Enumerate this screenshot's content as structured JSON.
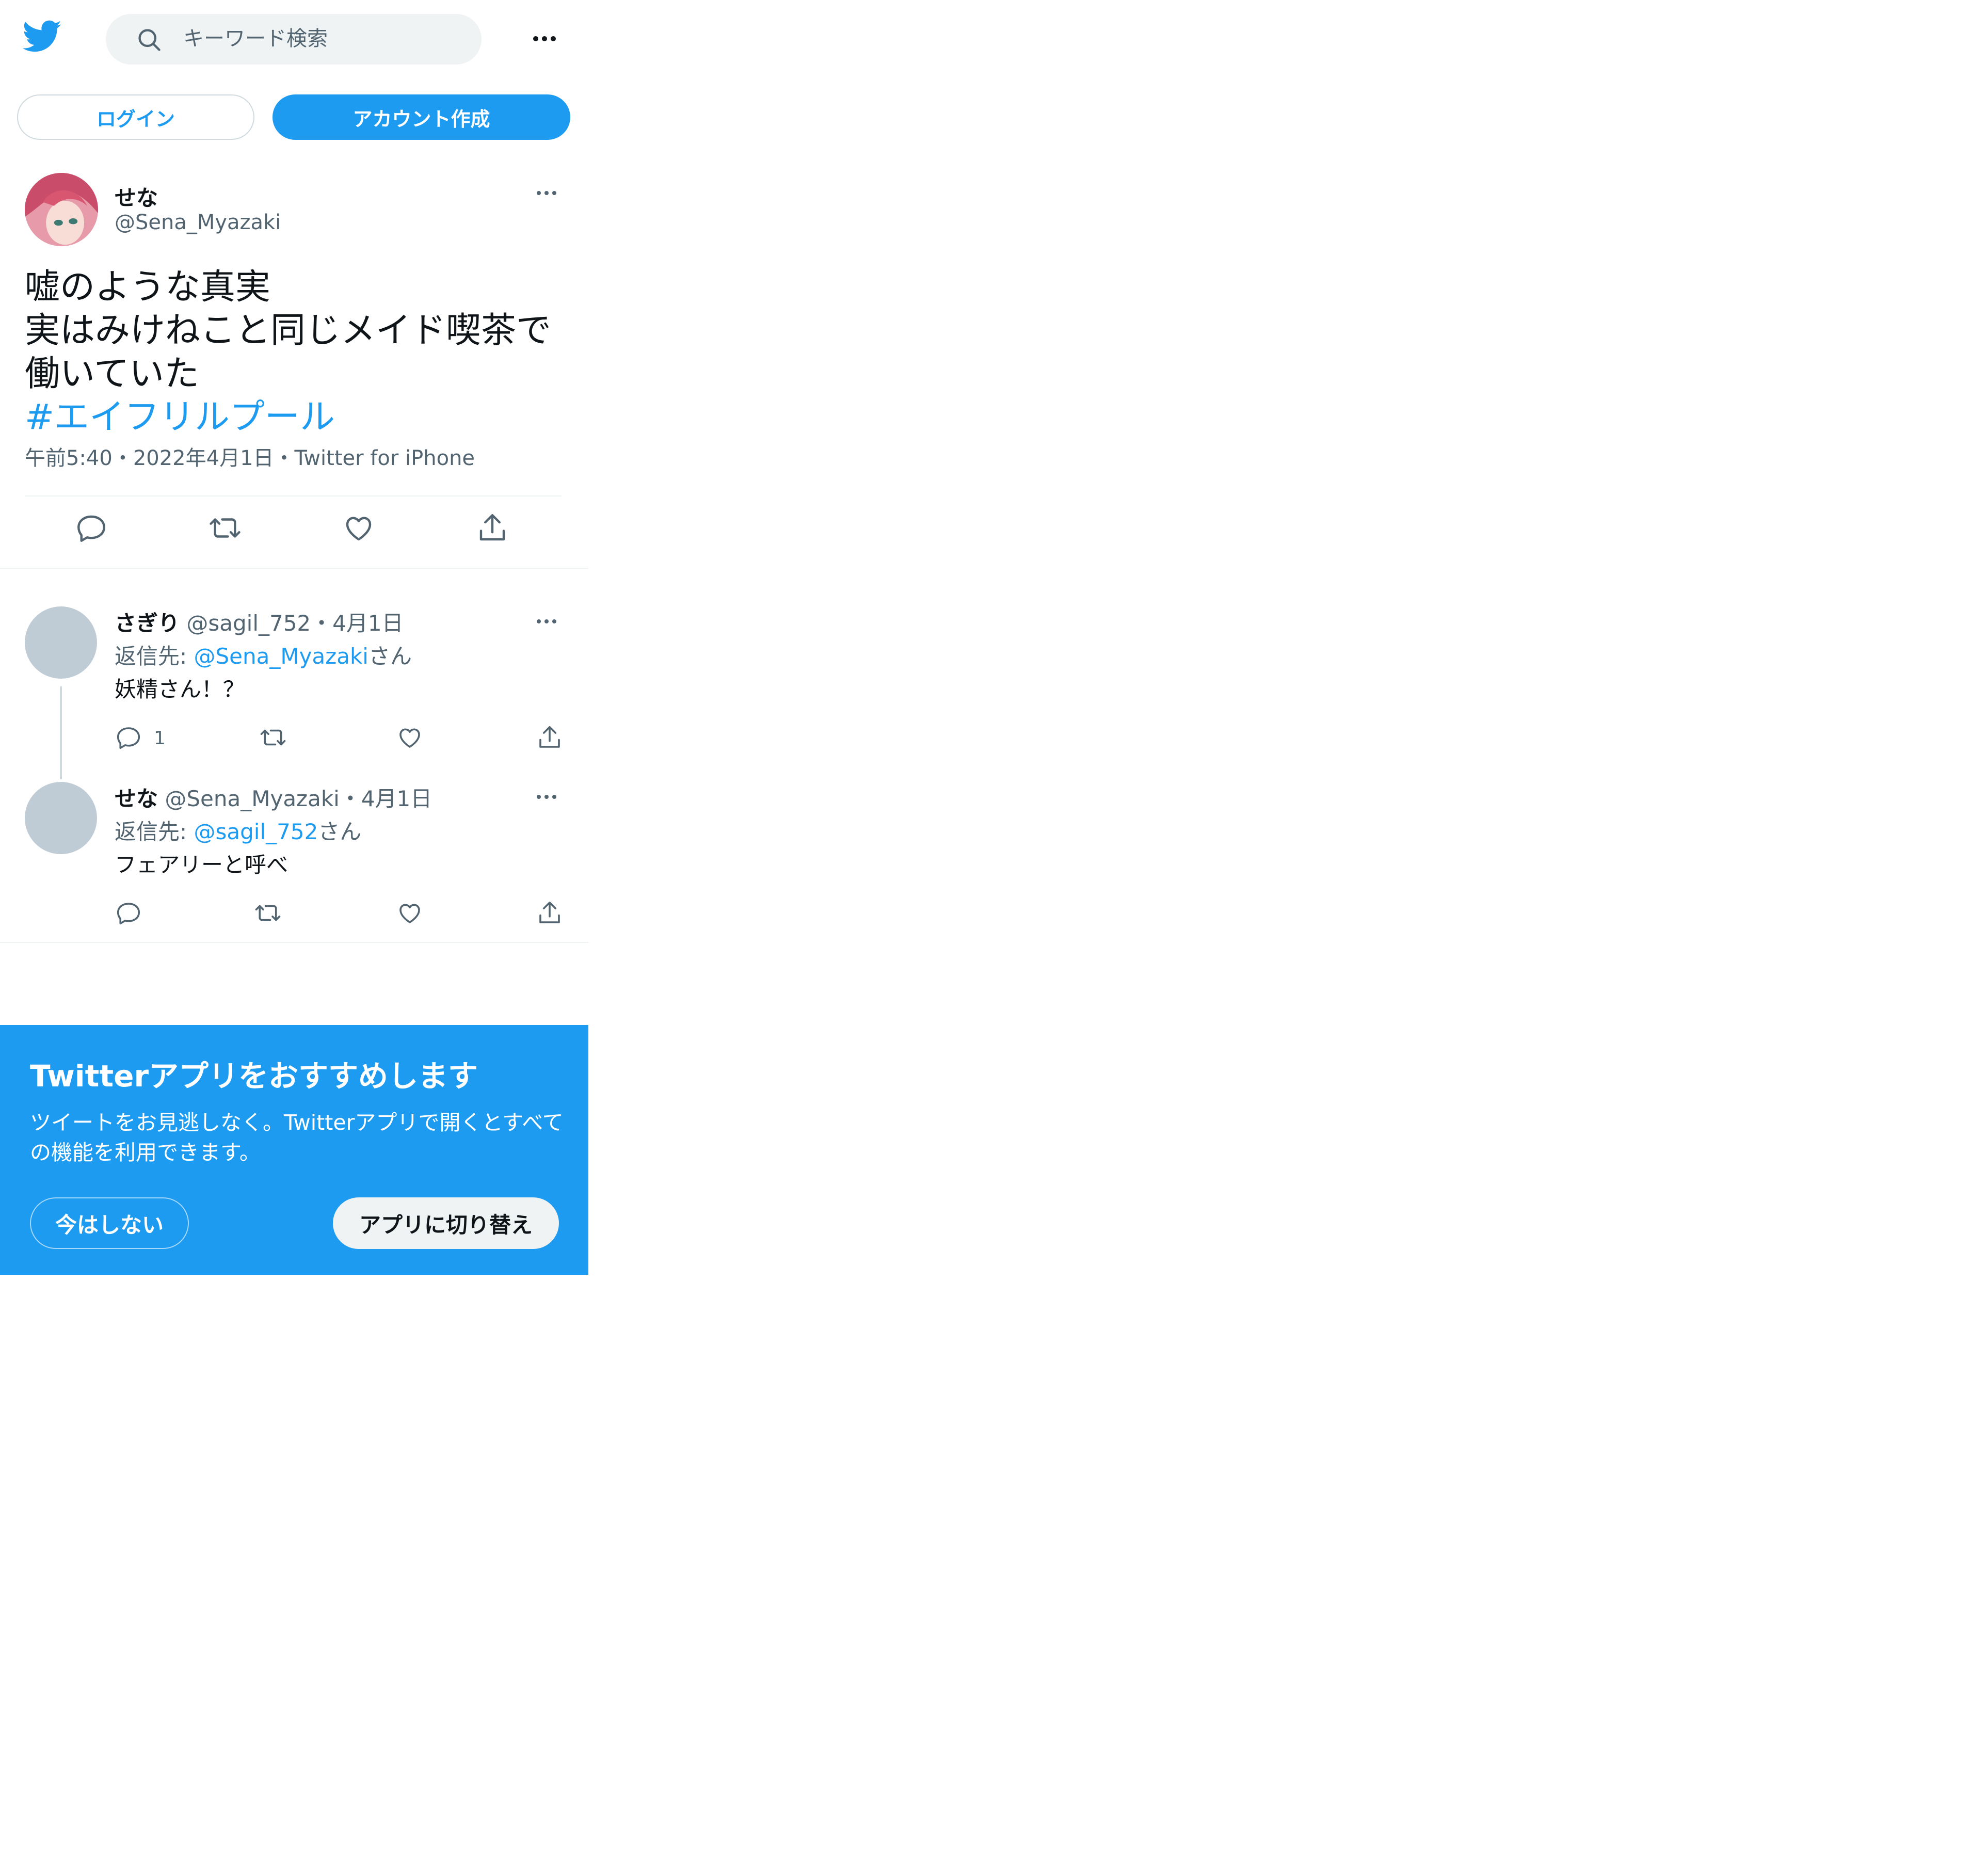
{
  "colors": {
    "accent": "#1d9bf0",
    "text": "#0f1419",
    "muted": "#536471",
    "promo_bg": "#1d9bf0"
  },
  "header": {
    "logo_icon": "twitter-bird-icon",
    "search_placeholder": "キーワード検索",
    "more_icon": "more-dots-icon"
  },
  "auth": {
    "login_label": "ログイン",
    "signup_label": "アカウント作成"
  },
  "tweet": {
    "name": "せな",
    "handle": "@Sena_Myazaki",
    "text_lines": [
      "嘘のような真実",
      "実はみけねこと同じメイド喫茶で",
      "働いていた"
    ],
    "hashtag": "#エイフリルプール",
    "meta": "午前5:40・2022年4月1日・Twitter for iPhone",
    "actions": [
      "reply-icon",
      "retweet-icon",
      "like-icon",
      "share-icon"
    ]
  },
  "replies": [
    {
      "name": "さぎり",
      "handle_date": "@sagil_752・4月1日",
      "reply_to_prefix": "返信先: ",
      "reply_to_handle": "@Sena_Myazaki",
      "reply_to_suffix": "さん",
      "text": "妖精さん！？",
      "reply_count": "1"
    },
    {
      "name": "せな",
      "handle_date": "@Sena_Myazaki・4月1日",
      "reply_to_prefix": "返信先: ",
      "reply_to_handle": "@sagil_752",
      "reply_to_suffix": "さん",
      "text": "フェアリーと呼べ",
      "reply_count": ""
    }
  ],
  "promo": {
    "title": "Twitterアプリをおすすめします",
    "description": "ツイートをお見逃しなく。Twitterアプリで開くとすべての機能を利用できます。",
    "later_label": "今はしない",
    "switch_label": "アプリに切り替え"
  }
}
